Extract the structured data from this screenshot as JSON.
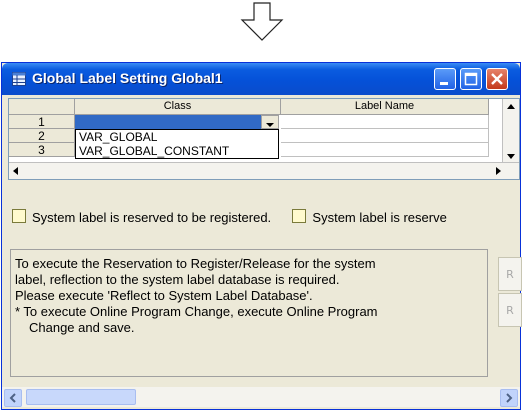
{
  "window": {
    "title": "Global Label Setting Global1"
  },
  "grid": {
    "columns": [
      "Class",
      "Label Name"
    ],
    "rows": [
      "1",
      "2",
      "3"
    ],
    "dropdown_options": [
      "VAR_GLOBAL",
      "VAR_GLOBAL_CONSTANT"
    ]
  },
  "legend": {
    "item1": "System label is reserved to be registered.",
    "item2": "System label is reserve"
  },
  "message": {
    "line1": "To execute the Reservation to Register/Release for the system",
    "line2": "label, reflection to the system label database is required.",
    "line3": "Please execute 'Reflect to System Label Database'.",
    "line4": "* To execute Online Program Change, execute Online Program",
    "line5": "Change and save."
  },
  "side_buttons": [
    "R",
    "R"
  ],
  "colors": {
    "title": "#0b5ce0",
    "selection": "#316ac5",
    "swatch": "#fffacd"
  }
}
